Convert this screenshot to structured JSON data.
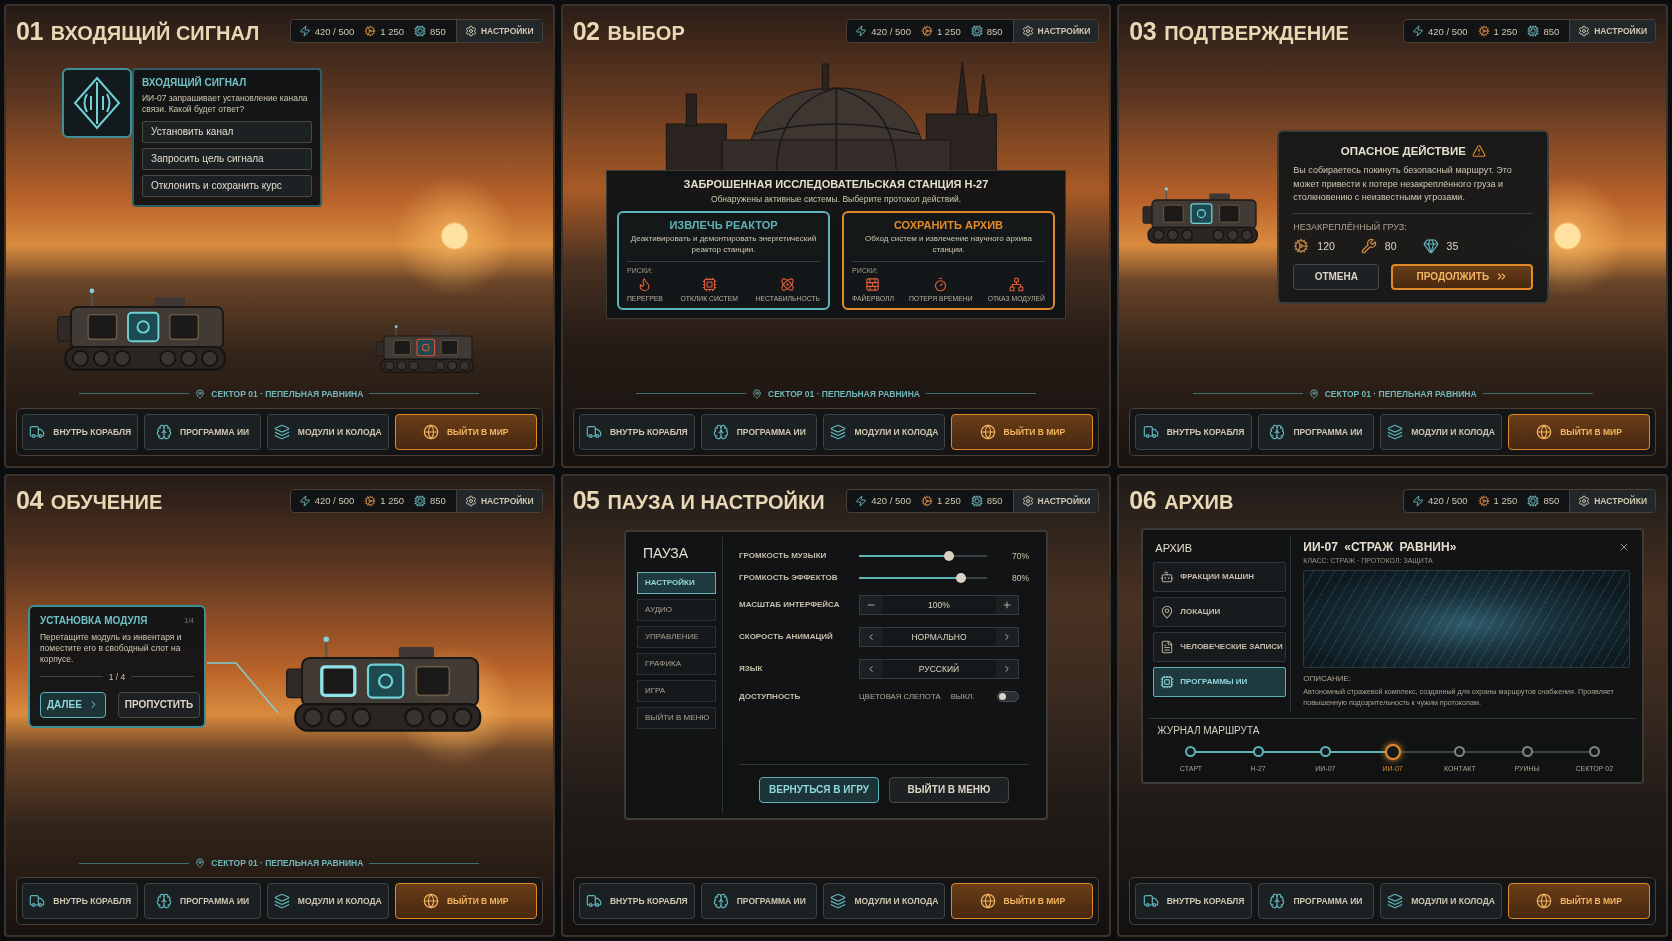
{
  "panels": [
    {
      "kind": "signal",
      "number": "01",
      "title": "ВХОДЯЩИЙ СИГНАЛ",
      "resources": [
        {
          "kind": "energy",
          "value": "420 / 500"
        },
        {
          "kind": "scrap",
          "value": "1 250"
        },
        {
          "kind": "chips",
          "value": "850"
        }
      ],
      "settings_button": "НАСТРОЙКИ",
      "dialog": {
        "title": "ВХОДЯЩИЙ СИГНАЛ",
        "text": "ИИ-07 запрашивает установление канала связи. Какой будет ответ?",
        "options": [
          "Установить канал",
          "Запросить цель сигнала",
          "Отклонить и сохранить курс"
        ]
      },
      "location": "СЕКТОР 01 · ПЕПЕЛЬНАЯ РАВНИНА",
      "nav": [
        {
          "kind": "ship",
          "label": "ВНУТРЬ КОРАБЛЯ",
          "primary": false
        },
        {
          "kind": "ai",
          "label": "ПРОГРАММА ИИ",
          "primary": false
        },
        {
          "kind": "modules",
          "label": "МОДУЛИ И КОЛОДА",
          "primary": false
        },
        {
          "kind": "world",
          "label": "ВЫЙТИ В МИР",
          "primary": true
        }
      ]
    },
    {
      "kind": "choice",
      "number": "02",
      "title": "ВЫБОР",
      "resources": [
        {
          "kind": "energy",
          "value": "420 / 500"
        },
        {
          "kind": "scrap",
          "value": "1 250"
        },
        {
          "kind": "chips",
          "value": "850"
        }
      ],
      "settings_button": "НАСТРОЙКИ",
      "event": {
        "title": "ЗАБРОШЕННАЯ ИССЛЕДОВАТЕЛЬСКАЯ СТАНЦИЯ Н-27",
        "text": "Обнаружены активные системы. Выберите протокол действий.",
        "options": [
          {
            "title": "ИЗВЛЕЧЬ РЕАКТОР",
            "text": "Деактивировать и демонтировать энергетический реактор станции.",
            "color": "#5fb3b8",
            "risks_label": "РИСКИ:",
            "risks": [
              {
                "kind": "overheat",
                "label": "ПЕРЕГРЕВ"
              },
              {
                "kind": "response",
                "label": "ОТКЛИК СИСТЕМ"
              },
              {
                "kind": "instability",
                "label": "НЕСТАБИЛЬНОСТЬ"
              }
            ]
          },
          {
            "title": "СОХРАНИТЬ АРХИВ",
            "text": "Обход систем и извлечение научного архива станции.",
            "color": "#e08a2c",
            "risks_label": "РИСКИ:",
            "risks": [
              {
                "kind": "firewall",
                "label": "ФАЙЕРВОЛЛ"
              },
              {
                "kind": "time",
                "label": "ПОТЕРЯ ВРЕМЕНИ"
              },
              {
                "kind": "modules",
                "label": "ОТКАЗ МОДУЛЕЙ"
              }
            ]
          }
        ]
      },
      "location": "СЕКТОР 01 · ПЕПЕЛЬНАЯ РАВНИНА",
      "nav": [
        {
          "kind": "ship",
          "label": "ВНУТРЬ КОРАБЛЯ",
          "primary": false
        },
        {
          "kind": "ai",
          "label": "ПРОГРАММА ИИ",
          "primary": false
        },
        {
          "kind": "modules",
          "label": "МОДУЛИ И КОЛОДА",
          "primary": false
        },
        {
          "kind": "world",
          "label": "ВЫЙТИ В МИР",
          "primary": true
        }
      ]
    },
    {
      "kind": "confirm",
      "number": "03",
      "title": "ПОДТВЕРЖДЕНИЕ",
      "resources": [
        {
          "kind": "energy",
          "value": "420 / 500"
        },
        {
          "kind": "scrap",
          "value": "1 250"
        },
        {
          "kind": "chips",
          "value": "850"
        }
      ],
      "settings_button": "НАСТРОЙКИ",
      "dialog": {
        "title": "ОПАСНОЕ ДЕЙСТВИЕ",
        "text": "Вы собираетесь покинуть безопасный маршрут. Это может привести к потере незакреплённого груза и столкновению с неизвестными угрозами.",
        "cargo_label": "НЕЗАКРЕПЛЁННЫЙ ГРУЗ:",
        "cargo": [
          {
            "kind": "scrap",
            "value": "120"
          },
          {
            "kind": "parts",
            "value": "80"
          },
          {
            "kind": "crystal",
            "value": "35"
          }
        ],
        "cancel": "ОТМЕНА",
        "confirm": "ПРОДОЛЖИТЬ"
      },
      "location": "СЕКТОР 01 · ПЕПЕЛЬНАЯ РАВНИНА",
      "nav": [
        {
          "kind": "ship",
          "label": "ВНУТРЬ КОРАБЛЯ",
          "primary": false
        },
        {
          "kind": "ai",
          "label": "ПРОГРАММА ИИ",
          "primary": false
        },
        {
          "kind": "modules",
          "label": "МОДУЛИ И КОЛОДА",
          "primary": false
        },
        {
          "kind": "world",
          "label": "ВЫЙТИ В МИР",
          "primary": true
        }
      ]
    },
    {
      "kind": "tutorial",
      "number": "04",
      "title": "ОБУЧЕНИЕ",
      "resources": [
        {
          "kind": "energy",
          "value": "420 / 500"
        },
        {
          "kind": "scrap",
          "value": "1 250"
        },
        {
          "kind": "chips",
          "value": "850"
        }
      ],
      "settings_button": "НАСТРОЙКИ",
      "tip": {
        "title": "УСТАНОВКА МОДУЛЯ",
        "badge": "1/4",
        "text": "Перетащите модуль из инвентаря и поместите его в свободный слот на корпусе.",
        "step": "1 / 4",
        "next": "ДАЛЕЕ",
        "skip": "ПРОПУСТИТЬ"
      },
      "location": "СЕКТОР 01 · ПЕПЕЛЬНАЯ РАВНИНА",
      "nav": [
        {
          "kind": "ship",
          "label": "ВНУТРЬ КОРАБЛЯ",
          "primary": false
        },
        {
          "kind": "ai",
          "label": "ПРОГРАММА ИИ",
          "primary": false
        },
        {
          "kind": "modules",
          "label": "МОДУЛИ И КОЛОДА",
          "primary": false
        },
        {
          "kind": "world",
          "label": "ВЫЙТИ В МИР",
          "primary": true
        }
      ]
    },
    {
      "kind": "pause",
      "number": "05",
      "title": "ПАУЗА И НАСТРОЙКИ",
      "resources": [
        {
          "kind": "energy",
          "value": "420 / 500"
        },
        {
          "kind": "scrap",
          "value": "1 250"
        },
        {
          "kind": "chips",
          "value": "850"
        }
      ],
      "settings_button": "НАСТРОЙКИ",
      "menu": {
        "title": "ПАУЗА",
        "items": [
          {
            "label": "НАСТРОЙКИ",
            "selected": true
          },
          {
            "label": "АУДИО",
            "selected": false
          },
          {
            "label": "УПРАВЛЕНИЕ",
            "selected": false
          },
          {
            "label": "ГРАФИКА",
            "selected": false
          },
          {
            "label": "ИГРА",
            "selected": false
          },
          {
            "label": "ВЫЙТИ В МЕНЮ",
            "selected": false
          }
        ]
      },
      "options": [
        {
          "kind": "slider",
          "label": "ГРОМКОСТЬ МУЗЫКИ",
          "level": 0.7,
          "reading": "70%"
        },
        {
          "kind": "slider",
          "label": "ГРОМКОСТЬ ЭФФЕКТОВ",
          "level": 0.8,
          "reading": "80%"
        },
        {
          "kind": "stepper",
          "label": "МАСШТАБ ИНТЕРФЕЙСА",
          "value": "100%"
        },
        {
          "kind": "selector",
          "label": "СКОРОСТЬ АНИМАЦИЙ",
          "value": "НОРМАЛЬНО"
        },
        {
          "kind": "selector",
          "label": "ЯЗЫК",
          "value": "РУССКИЙ"
        },
        {
          "kind": "toggle",
          "label": "ДОСТУПНОСТЬ",
          "option": "ЦВЕТОВАЯ СЛЕПОТА",
          "state": "ВЫКЛ.",
          "on": false
        }
      ],
      "buttons": [
        {
          "label": "ВЕРНУТЬСЯ В ИГРУ",
          "primary": true
        },
        {
          "label": "ВЫЙТИ В МЕНЮ",
          "primary": false
        }
      ],
      "nav": [
        {
          "kind": "ship",
          "label": "ВНУТРЬ КОРАБЛЯ",
          "primary": false
        },
        {
          "kind": "ai",
          "label": "ПРОГРАММА ИИ",
          "primary": false
        },
        {
          "kind": "modules",
          "label": "МОДУЛИ И КОЛОДА",
          "primary": false
        },
        {
          "kind": "world",
          "label": "ВЫЙТИ В МИР",
          "primary": true
        }
      ]
    },
    {
      "kind": "archive",
      "number": "06",
      "title": "АРХИВ",
      "resources": [
        {
          "kind": "energy",
          "value": "420 / 500"
        },
        {
          "kind": "scrap",
          "value": "1 250"
        },
        {
          "kind": "chips",
          "value": "850"
        }
      ],
      "settings_button": "НАСТРОЙКИ",
      "archive": {
        "title": "АРХИВ",
        "items": [
          {
            "kind": "factions",
            "label": "ФРАКЦИИ МАШИН",
            "selected": false
          },
          {
            "kind": "locations",
            "label": "ЛОКАЦИИ",
            "selected": false
          },
          {
            "kind": "records",
            "label": "ЧЕЛОВЕЧЕСКИЕ ЗАПИСИ",
            "selected": false
          },
          {
            "kind": "programs",
            "label": "ПРОГРАММЫ ИИ",
            "selected": true
          }
        ]
      },
      "entry": {
        "title": "ИИ-07 «СТРАЖ РАВНИН»",
        "meta": "КЛАСС: СТРАЖ · ПРОТОКОЛ: ЗАЩИТА",
        "description_label": "ОПИСАНИЕ:",
        "description": "Автономный стражевой комплекс, созданный для охраны маршрутов снабжения. Проявляет повышенную подозрительность к чужим протоколам."
      },
      "route": {
        "title": "ЖУРНАЛ МАРШРУТА",
        "nodes": [
          {
            "label": "СТАРТ",
            "kind": "visited"
          },
          {
            "label": "Н-27",
            "kind": "visited"
          },
          {
            "label": "ИИ-07",
            "kind": "visited"
          },
          {
            "label": "ИИ-07",
            "kind": "current"
          },
          {
            "label": "КОНТАКТ",
            "kind": "upcoming"
          },
          {
            "label": "РУИНЫ",
            "kind": "upcoming"
          },
          {
            "label": "СЕКТОР 02",
            "kind": "upcoming"
          }
        ]
      },
      "nav": [
        {
          "kind": "ship",
          "label": "ВНУТРЬ КОРАБЛЯ",
          "primary": false
        },
        {
          "kind": "ai",
          "label": "ПРОГРАММА ИИ",
          "primary": false
        },
        {
          "kind": "modules",
          "label": "МОДУЛИ И КОЛОДА",
          "primary": false
        },
        {
          "kind": "world",
          "label": "ВЫЙТИ В МИР",
          "primary": true
        }
      ]
    }
  ]
}
